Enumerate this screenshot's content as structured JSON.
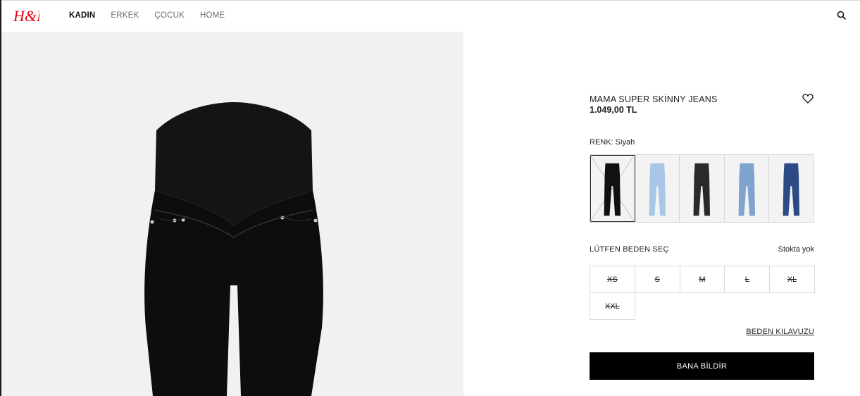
{
  "header": {
    "logo_text": "H&M",
    "nav": [
      "KADIN",
      "ERKEK",
      "ÇOCUK",
      "HOME"
    ],
    "active_nav": "KADIN",
    "icons": {
      "search": "search-icon"
    }
  },
  "product": {
    "title": "MAMA SUPER SKİNNY JEANS",
    "price": "1.049,00 TL",
    "color_label": "RENK: Siyah",
    "swatches": [
      {
        "name": "black",
        "color": "#111111",
        "selected": true
      },
      {
        "name": "light-blue",
        "color": "#a9c6e6",
        "selected": false
      },
      {
        "name": "washed-black",
        "color": "#2a2a2a",
        "selected": false
      },
      {
        "name": "mid-blue",
        "color": "#7fa3cc",
        "selected": false
      },
      {
        "name": "dark-blue",
        "color": "#2c4a86",
        "selected": false
      }
    ],
    "size_label": "LÜTFEN BEDEN SEÇ",
    "stock_status": "Stokta yok",
    "sizes": [
      "XS",
      "S",
      "M",
      "L",
      "XL",
      "XXL"
    ],
    "size_guide": "BEDEN KILAVUZU",
    "notify_button": "BANA BİLDİR"
  },
  "colors": {
    "accent_red": "#e50010",
    "button_bg": "#000000",
    "image_bg": "#f1f1f1"
  }
}
